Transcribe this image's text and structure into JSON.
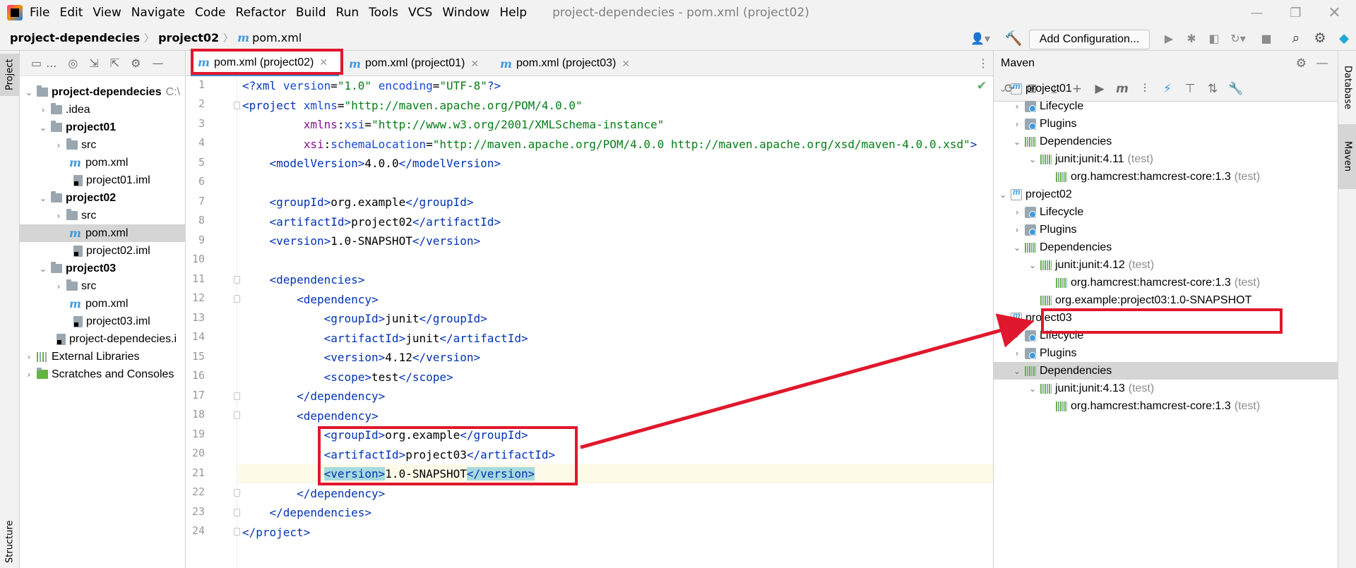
{
  "menubar": {
    "items": [
      "File",
      "Edit",
      "View",
      "Navigate",
      "Code",
      "Refactor",
      "Build",
      "Run",
      "Tools",
      "VCS",
      "Window",
      "Help"
    ],
    "window_title": "project-dependecies - pom.xml (project02)"
  },
  "navbar": {
    "breadcrumb": [
      "project-dependecies",
      "project02",
      "pom.xml"
    ],
    "add_configuration": "Add Configuration..."
  },
  "left_strip": {
    "project_tab": "Project",
    "structure_tab": "Structure"
  },
  "right_strip": {
    "database_tab": "Database",
    "maven_tab": "Maven"
  },
  "project_tree": {
    "toolbar_dots": "...",
    "rows": [
      {
        "label": "project-dependecies",
        "suffix": "C:\\",
        "bold": true
      },
      {
        "label": ".idea"
      },
      {
        "label": "project01",
        "bold": true
      },
      {
        "label": "src"
      },
      {
        "label": "pom.xml"
      },
      {
        "label": "project01.iml"
      },
      {
        "label": "project02",
        "bold": true
      },
      {
        "label": "src"
      },
      {
        "label": "pom.xml",
        "selected": true
      },
      {
        "label": "project02.iml"
      },
      {
        "label": "project03",
        "bold": true
      },
      {
        "label": "src"
      },
      {
        "label": "pom.xml"
      },
      {
        "label": "project03.iml"
      },
      {
        "label": "project-dependecies.i"
      },
      {
        "label": "External Libraries"
      },
      {
        "label": "Scratches and Consoles"
      }
    ]
  },
  "editor": {
    "tabs": [
      {
        "label": "pom.xml (project02)",
        "active": true
      },
      {
        "label": "pom.xml (project01)"
      },
      {
        "label": "pom.xml (project03)"
      }
    ],
    "line_numbers": [
      "1",
      "2",
      "3",
      "4",
      "5",
      "6",
      "7",
      "8",
      "9",
      "10",
      "11",
      "12",
      "13",
      "14",
      "15",
      "16",
      "17",
      "18",
      "19",
      "20",
      "21",
      "22",
      "23",
      "24"
    ],
    "lines": [
      "<?xml version=\"1.0\" encoding=\"UTF-8\"?>",
      "<project xmlns=\"http://maven.apache.org/POM/4.0.0\"",
      "         xmlns:xsi=\"http://www.w3.org/2001/XMLSchema-instance\"",
      "         xsi:schemaLocation=\"http://maven.apache.org/POM/4.0.0 http://maven.apache.org/xsd/maven-4.0.0.xsd\">",
      "    <modelVersion>4.0.0</modelVersion>",
      "",
      "    <groupId>org.example</groupId>",
      "    <artifactId>project02</artifactId>",
      "    <version>1.0-SNAPSHOT</version>",
      "",
      "    <dependencies>",
      "        <dependency>",
      "            <groupId>junit</groupId>",
      "            <artifactId>junit</artifactId>",
      "            <version>4.12</version>",
      "            <scope>test</scope>",
      "        </dependency>",
      "        <dependency>",
      "            <groupId>org.example</groupId>",
      "            <artifactId>project03</artifactId>",
      "            <version>1.0-SNAPSHOT</version>",
      "        </dependency>",
      "    </dependencies>",
      "</project>"
    ]
  },
  "maven": {
    "title": "Maven",
    "rows": [
      {
        "label": "project01"
      },
      {
        "label": "Lifecycle"
      },
      {
        "label": "Plugins"
      },
      {
        "label": "Dependencies"
      },
      {
        "label": "junit:junit:4.11",
        "scope": "(test)"
      },
      {
        "label": "org.hamcrest:hamcrest-core:1.3",
        "scope": "(test)"
      },
      {
        "label": "project02"
      },
      {
        "label": "Lifecycle"
      },
      {
        "label": "Plugins"
      },
      {
        "label": "Dependencies"
      },
      {
        "label": "junit:junit:4.12",
        "scope": "(test)"
      },
      {
        "label": "org.hamcrest:hamcrest-core:1.3",
        "scope": "(test)"
      },
      {
        "label": "org.example:project03:1.0-SNAPSHOT"
      },
      {
        "label": "project03"
      },
      {
        "label": "Lifecycle"
      },
      {
        "label": "Plugins"
      },
      {
        "label": "Dependencies",
        "selected": true
      },
      {
        "label": "junit:junit:4.13",
        "scope": "(test)"
      },
      {
        "label": "org.hamcrest:hamcrest-core:1.3",
        "scope": "(test)"
      }
    ]
  },
  "colors": {
    "annotation_red": "#e0182d",
    "maven_blue": "#3d9be0",
    "tag_blue": "#0033b3",
    "string_green": "#067d17"
  }
}
